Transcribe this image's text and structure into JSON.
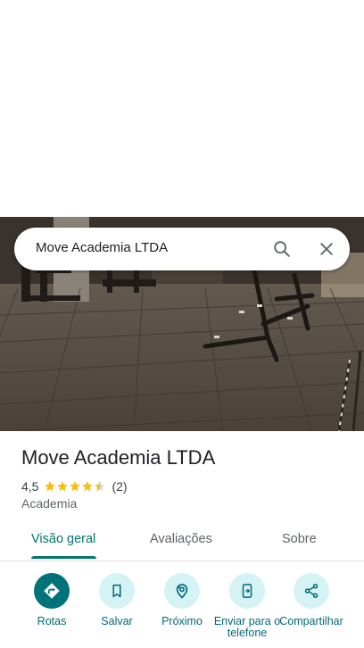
{
  "search": {
    "query": "Move Academia LTDA"
  },
  "place": {
    "name": "Move Academia LTDA",
    "rating": "4,5",
    "rating_value": 4.5,
    "rating_max": 5,
    "review_count": "(2)",
    "category": "Academia"
  },
  "tabs": [
    {
      "label": "Visão geral",
      "active": true
    },
    {
      "label": "Avaliações",
      "active": false
    },
    {
      "label": "Sobre",
      "active": false
    }
  ],
  "actions": [
    {
      "label": "Rotas",
      "icon": "directions-icon"
    },
    {
      "label": "Salvar",
      "icon": "bookmark-icon"
    },
    {
      "label": "Próximo",
      "icon": "nearby-icon"
    },
    {
      "label": "Enviar para o telefone",
      "icon": "send-to-phone-icon"
    },
    {
      "label": "Compartilhar",
      "icon": "share-icon"
    }
  ],
  "colors": {
    "accent": "#00796b",
    "primary_button": "#00727a",
    "secondary_button": "#d5f3f5",
    "star": "#fbbc04"
  }
}
